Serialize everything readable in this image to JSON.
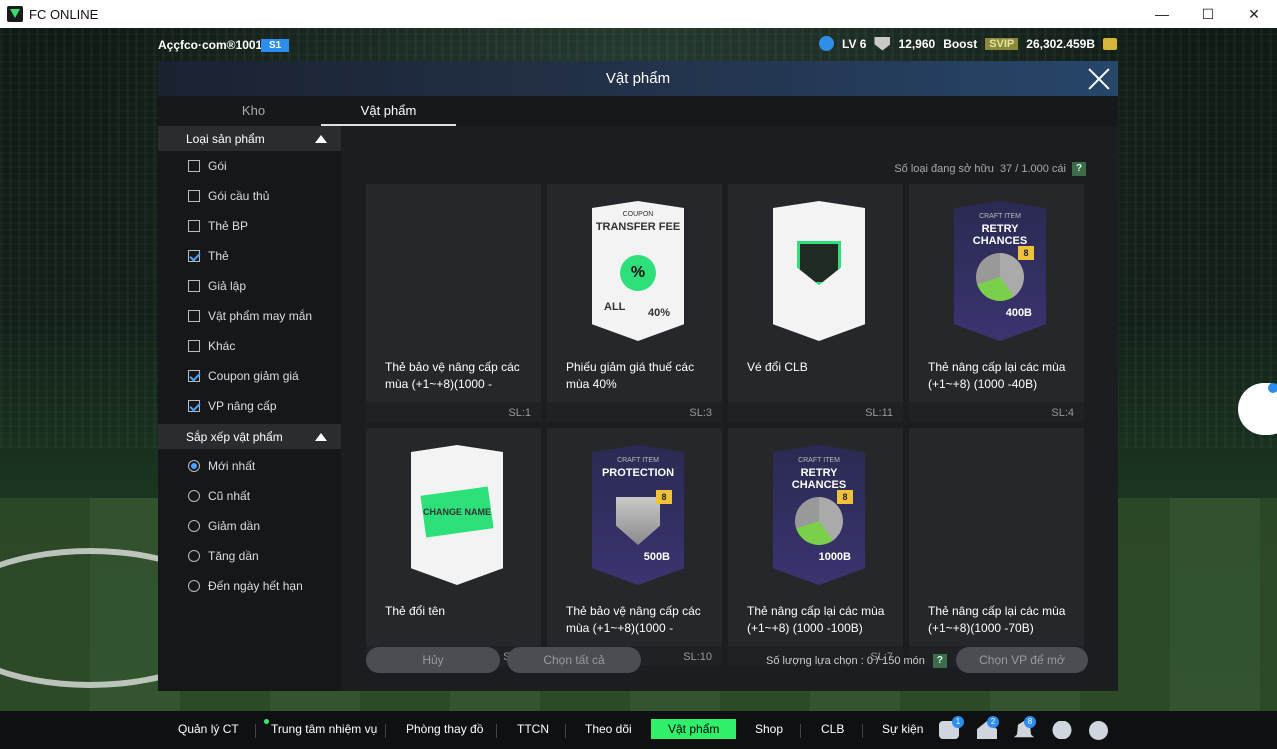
{
  "window": {
    "title": "FC ONLINE",
    "minimize": "—",
    "maximize": "☐",
    "close": "✕"
  },
  "hud": {
    "username": "Aççfco·com®1001u",
    "tag": "S1",
    "level": "LV 6",
    "shield_count": "12,960",
    "boost_label": "Boost",
    "svip": "SVIP",
    "coins": "26,302.459B"
  },
  "modal": {
    "title": "Vật phẩm",
    "tabs": [
      {
        "label": "Kho"
      },
      {
        "label": "Vật phẩm"
      }
    ],
    "owned_label": "Số loại đang sở hữu",
    "owned_value": "37 / 1.000 cái",
    "help": "?"
  },
  "sidebar": {
    "product_type": {
      "title": "Loại sản phẩm",
      "options": [
        {
          "label": "Gói",
          "checked": false
        },
        {
          "label": "Gói cầu thủ",
          "checked": false
        },
        {
          "label": "Thẻ BP",
          "checked": false
        },
        {
          "label": "Thẻ",
          "checked": true
        },
        {
          "label": "Giả lập",
          "checked": false
        },
        {
          "label": "Vật phẩm may mắn",
          "checked": false
        },
        {
          "label": "Khác",
          "checked": false
        },
        {
          "label": "Coupon giảm giá",
          "checked": true
        },
        {
          "label": "VP nâng cấp",
          "checked": true
        }
      ]
    },
    "sort": {
      "title": "Sắp xếp vật phẩm",
      "options": [
        {
          "label": "Mới nhất",
          "selected": true
        },
        {
          "label": "Cũ nhất",
          "selected": false
        },
        {
          "label": "Giảm dần",
          "selected": false
        },
        {
          "label": "Tăng dần",
          "selected": false
        },
        {
          "label": "Đến ngày hết hạn",
          "selected": false
        }
      ]
    }
  },
  "items": [
    {
      "name": "Thẻ bảo vệ nâng cấp các mùa (+1~+8)(1000 -",
      "qty": "SL:1",
      "art": "none"
    },
    {
      "name": "Phiếu giảm giá thuế các mùa 40%",
      "qty": "SL:3",
      "art": "coupon",
      "art_label_top": "COUPON",
      "art_label": "TRANSFER FEE",
      "art_pct": "%",
      "art_all": "ALL",
      "art_value": "40%"
    },
    {
      "name": "Vé đổi CLB",
      "qty": "SL:11",
      "art": "club"
    },
    {
      "name": "Thẻ nâng cấp lại các mùa (+1~+8) (1000 -40B)",
      "qty": "SL:4",
      "art": "retry",
      "art_label_top": "CRAFT ITEM",
      "art_label": "RETRY CHANCES",
      "art_badge": "8",
      "art_value": "400B"
    },
    {
      "name": "Thẻ đổi tên",
      "qty": "SL:11",
      "art": "rename",
      "art_label": "CHANGE NAME"
    },
    {
      "name": "Thẻ bảo vệ nâng cấp các mùa (+1~+8)(1000 -",
      "qty": "SL:10",
      "art": "protect",
      "art_label_top": "CRAFT ITEM",
      "art_label": "PROTECTION",
      "art_badge": "8",
      "art_value": "500B"
    },
    {
      "name": "Thẻ nâng cấp lại các mùa (+1~+8) (1000 -100B)",
      "qty": "SL:7",
      "art": "retry",
      "art_label_top": "CRAFT ITEM",
      "art_label": "RETRY CHANCES",
      "art_badge": "8",
      "art_value": "1000B"
    },
    {
      "name": "Thẻ nâng cấp lại các mùa (+1~+8)(1000 -70B)",
      "qty": "SL:1",
      "art": "none"
    }
  ],
  "footer": {
    "cancel": "Hủy",
    "select_all": "Chọn tất cả",
    "selected_count_label": "Số lượng lựa chọn : 0 / 150 món",
    "help": "?",
    "upgrade": "Chọn VP để mở"
  },
  "bottom_nav": {
    "items": [
      {
        "label": "Quản lý CT",
        "active": false
      },
      {
        "label": "Trung tâm nhiệm vụ",
        "active": false
      },
      {
        "label": "Phòng thay đồ",
        "active": false
      },
      {
        "label": "TTCN",
        "active": false
      },
      {
        "label": "Theo dõi",
        "active": false
      },
      {
        "label": "Vật phẩm",
        "active": true
      },
      {
        "label": "Shop",
        "active": false
      },
      {
        "label": "CLB",
        "active": false
      },
      {
        "label": "Sự kiện",
        "active": false
      }
    ],
    "icons": [
      {
        "name": "chat-icon",
        "badge": "1"
      },
      {
        "name": "home-icon",
        "badge": "2"
      },
      {
        "name": "bell-icon",
        "badge": "8"
      },
      {
        "name": "profile-icon",
        "badge": ""
      },
      {
        "name": "gear-icon",
        "badge": ""
      }
    ]
  },
  "colors": {
    "accent": "#2ff06a",
    "tag_blue": "#2c8cf0",
    "modal_bg": "#1b1d21"
  }
}
